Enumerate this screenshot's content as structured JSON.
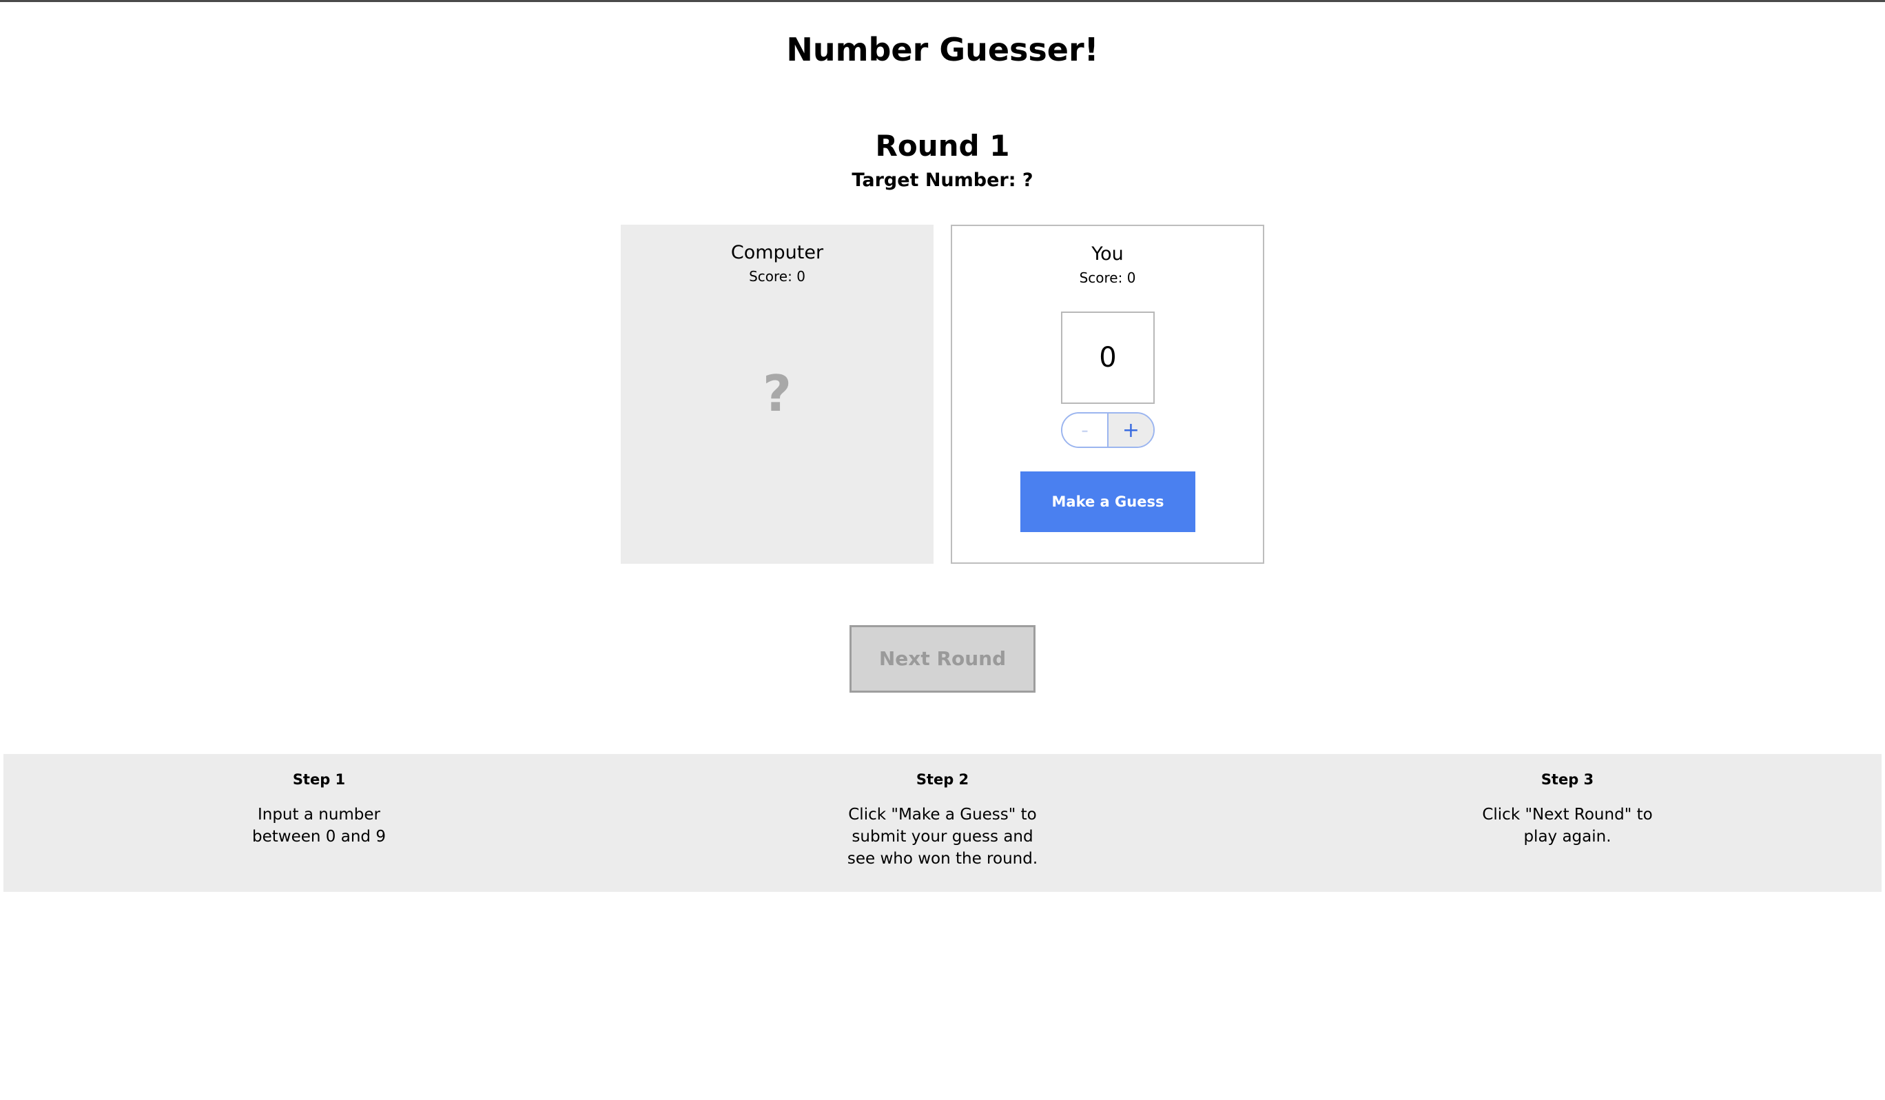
{
  "header": {
    "title": "Number Guesser!"
  },
  "round": {
    "label": "Round 1",
    "target_label": "Target Number: ?"
  },
  "computer": {
    "name": "Computer",
    "score_label": "Score: 0",
    "guess": "?"
  },
  "human": {
    "name": "You",
    "score_label": "Score: 0",
    "guess_value": "0",
    "decrement_label": "-",
    "increment_label": "+",
    "guess_button_label": "Make a Guess"
  },
  "controls": {
    "next_round_label": "Next Round"
  },
  "instructions": {
    "steps": [
      {
        "title": "Step 1",
        "text": "Input a number\nbetween 0 and 9"
      },
      {
        "title": "Step 2",
        "text": "Click \"Make a Guess\" to\nsubmit your guess and\nsee who won the round."
      },
      {
        "title": "Step 3",
        "text": "Click \"Next Round\" to\nplay again."
      }
    ]
  },
  "colors": {
    "primary": "#4a80f0",
    "panel_gray": "#ececec",
    "disabled_gray": "#d3d3d3"
  }
}
